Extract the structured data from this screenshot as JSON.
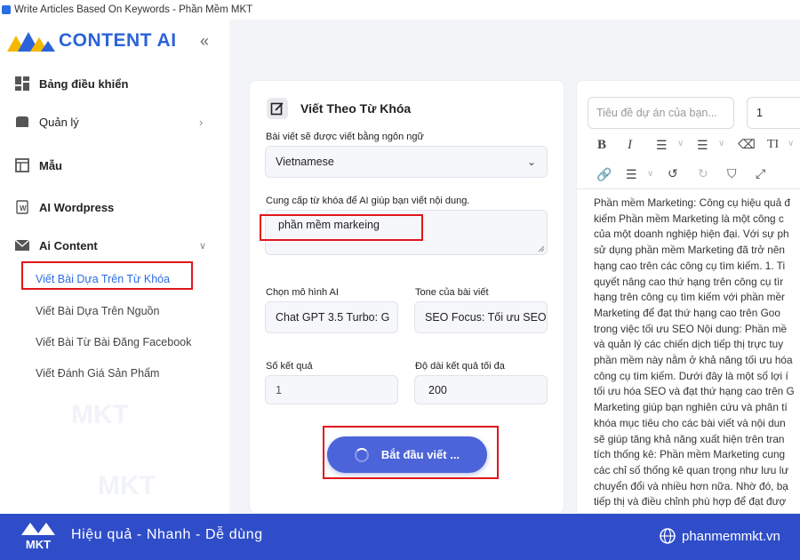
{
  "window": {
    "title": "Write Articles Based On Keywords - Phần Mềm MKT"
  },
  "sidebar": {
    "brand": "CONTENT AI",
    "collapse_icon": "chevron-left-double",
    "items": [
      {
        "label": "Bảng điều khiển",
        "icon": "dashboard-icon"
      },
      {
        "label": "Quản lý",
        "icon": "folder-icon",
        "has_children": true
      },
      {
        "label": "Mẫu",
        "icon": "template-icon"
      },
      {
        "label": "AI Wordpress",
        "icon": "wordpress-icon"
      },
      {
        "label": "Ai Content",
        "icon": "mail-icon",
        "expanded": true
      }
    ],
    "sub_items": [
      {
        "label": "Viết Bài Dựa Trên Từ Khóa",
        "active": true
      },
      {
        "label": "Viết Bài Dựa Trên Nguồn"
      },
      {
        "label": "Viết Bài Từ Bài Đăng Facebook"
      },
      {
        "label": "Viết Đánh Giá Sản Phẩm"
      }
    ]
  },
  "form": {
    "title": "Viết Theo Từ Khóa",
    "language_label": "Bài viết sẽ được viết bằng ngôn ngữ",
    "language_value": "Vietnamese",
    "keyword_label": "Cung cấp từ khóa để AI giúp bạn viết nội dung.",
    "keyword_value": "phần mềm markeing",
    "model_label": "Chọn mô hình AI",
    "model_value": "Chat GPT 3.5 Turbo: G",
    "tone_label": "Tone của bài viết",
    "tone_value": "SEO Focus: Tối ưu SEO",
    "results_label": "Số kết quả",
    "results_value": "1",
    "length_label": "Độ dài kết quả tối đa",
    "length_value": "200",
    "start_button": "Bắt đầu viết ..."
  },
  "editor": {
    "project_placeholder": "Tiêu đề dự án của bạn...",
    "count_value": "1",
    "lines": [
      "Phần mềm Marketing: Công cụ hiệu quả đ",
      "kiếm Phần mềm Marketing là một công c",
      "của một doanh nghiệp hiện đại. Với sự ph",
      "sử dụng phần mềm Marketing đã trở nên",
      "hạng cao trên các công cụ tìm kiếm. 1. Ti",
      "quyết nâng cao thứ hạng trên công cụ tìr",
      "hạng trên công cụ tìm kiếm với phần mềr",
      "Marketing để đạt thứ hạng cao trên Goo",
      "trong việc tối ưu SEO Nội dung: Phần mề",
      "và quản lý các chiến dịch tiếp thị trực tuy",
      "phần mềm này nằm ở khả năng tối ưu hóa",
      "công cụ tìm kiếm. Dưới đây là một số lợi í",
      "tối ưu hóa SEO và đạt thứ hạng cao trên G",
      "Marketing giúp bạn nghiên cứu và phân tí",
      "khóa mục tiêu cho các bài viết và nội dun",
      "sẽ giúp tăng khả năng xuất hiện trên tran",
      "tích thống kê: Phần mềm Marketing cung",
      "các chỉ số thống kê quan trọng như lưu lư",
      "chuyển đổi và nhiều hơn nữa. Nhờ đó, bạ",
      "tiếp thị và điều chỉnh phù hợp để đạt đượ"
    ]
  },
  "watermark": {
    "text": "MKT"
  },
  "footer": {
    "logo_text": "MKT",
    "slogan": "Hiệu quả - Nhanh  - Dễ dùng",
    "website": "phanmemmkt.vn"
  },
  "colors": {
    "accent": "#2b6de3",
    "button": "#4c64d9",
    "footer": "#2f4dc9",
    "highlight": "#e0161c"
  }
}
